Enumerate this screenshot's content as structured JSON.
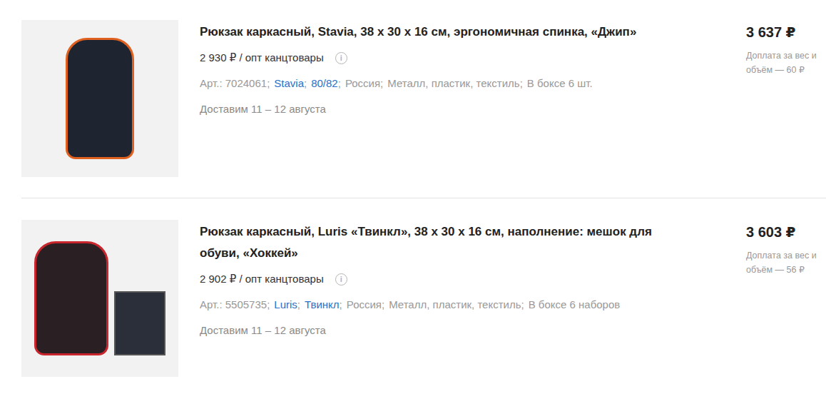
{
  "products": [
    {
      "title": "Рюкзак каркасный, Stavia, 38 х 30 х 16 см, эргономичная спинка, «Джип»",
      "wholesale": "2 930 ₽ / опт канцтовары",
      "info_icon": "i",
      "meta": [
        {
          "text": "Арт.: 7024061",
          "link": false,
          "sep": ";"
        },
        {
          "text": "Stavia",
          "link": true,
          "sep": ";"
        },
        {
          "text": "80/82",
          "link": true,
          "sep": ";"
        },
        {
          "text": "Россия",
          "link": false,
          "sep": ";"
        },
        {
          "text": "Металл, пластик, текстиль",
          "link": false,
          "sep": ";"
        },
        {
          "text": "В боксе 6 шт.",
          "link": false,
          "sep": ""
        }
      ],
      "delivery": "Доставим 11 – 12 августа",
      "price": "3 637 ₽",
      "surcharge": "Доплата за вес и объём — 60 ₽"
    },
    {
      "title": "Рюкзак каркасный, Luris «Твинкл», 38 х 30 х 16 см, наполнение: мешок для обуви, «Хоккей»",
      "wholesale": "2 902 ₽ / опт канцтовары",
      "info_icon": "i",
      "meta": [
        {
          "text": "Арт.: 5505735",
          "link": false,
          "sep": ";"
        },
        {
          "text": "Luris",
          "link": true,
          "sep": ";"
        },
        {
          "text": "Твинкл",
          "link": true,
          "sep": ";"
        },
        {
          "text": "Россия",
          "link": false,
          "sep": ";"
        },
        {
          "text": "Металл, пластик, текстиль",
          "link": false,
          "sep": ";"
        },
        {
          "text": "В боксе 6 наборов",
          "link": false,
          "sep": ""
        }
      ],
      "delivery": "Доставим 11 – 12 августа",
      "price": "3 603 ₽",
      "surcharge": "Доплата за вес и объём — 56 ₽"
    }
  ]
}
